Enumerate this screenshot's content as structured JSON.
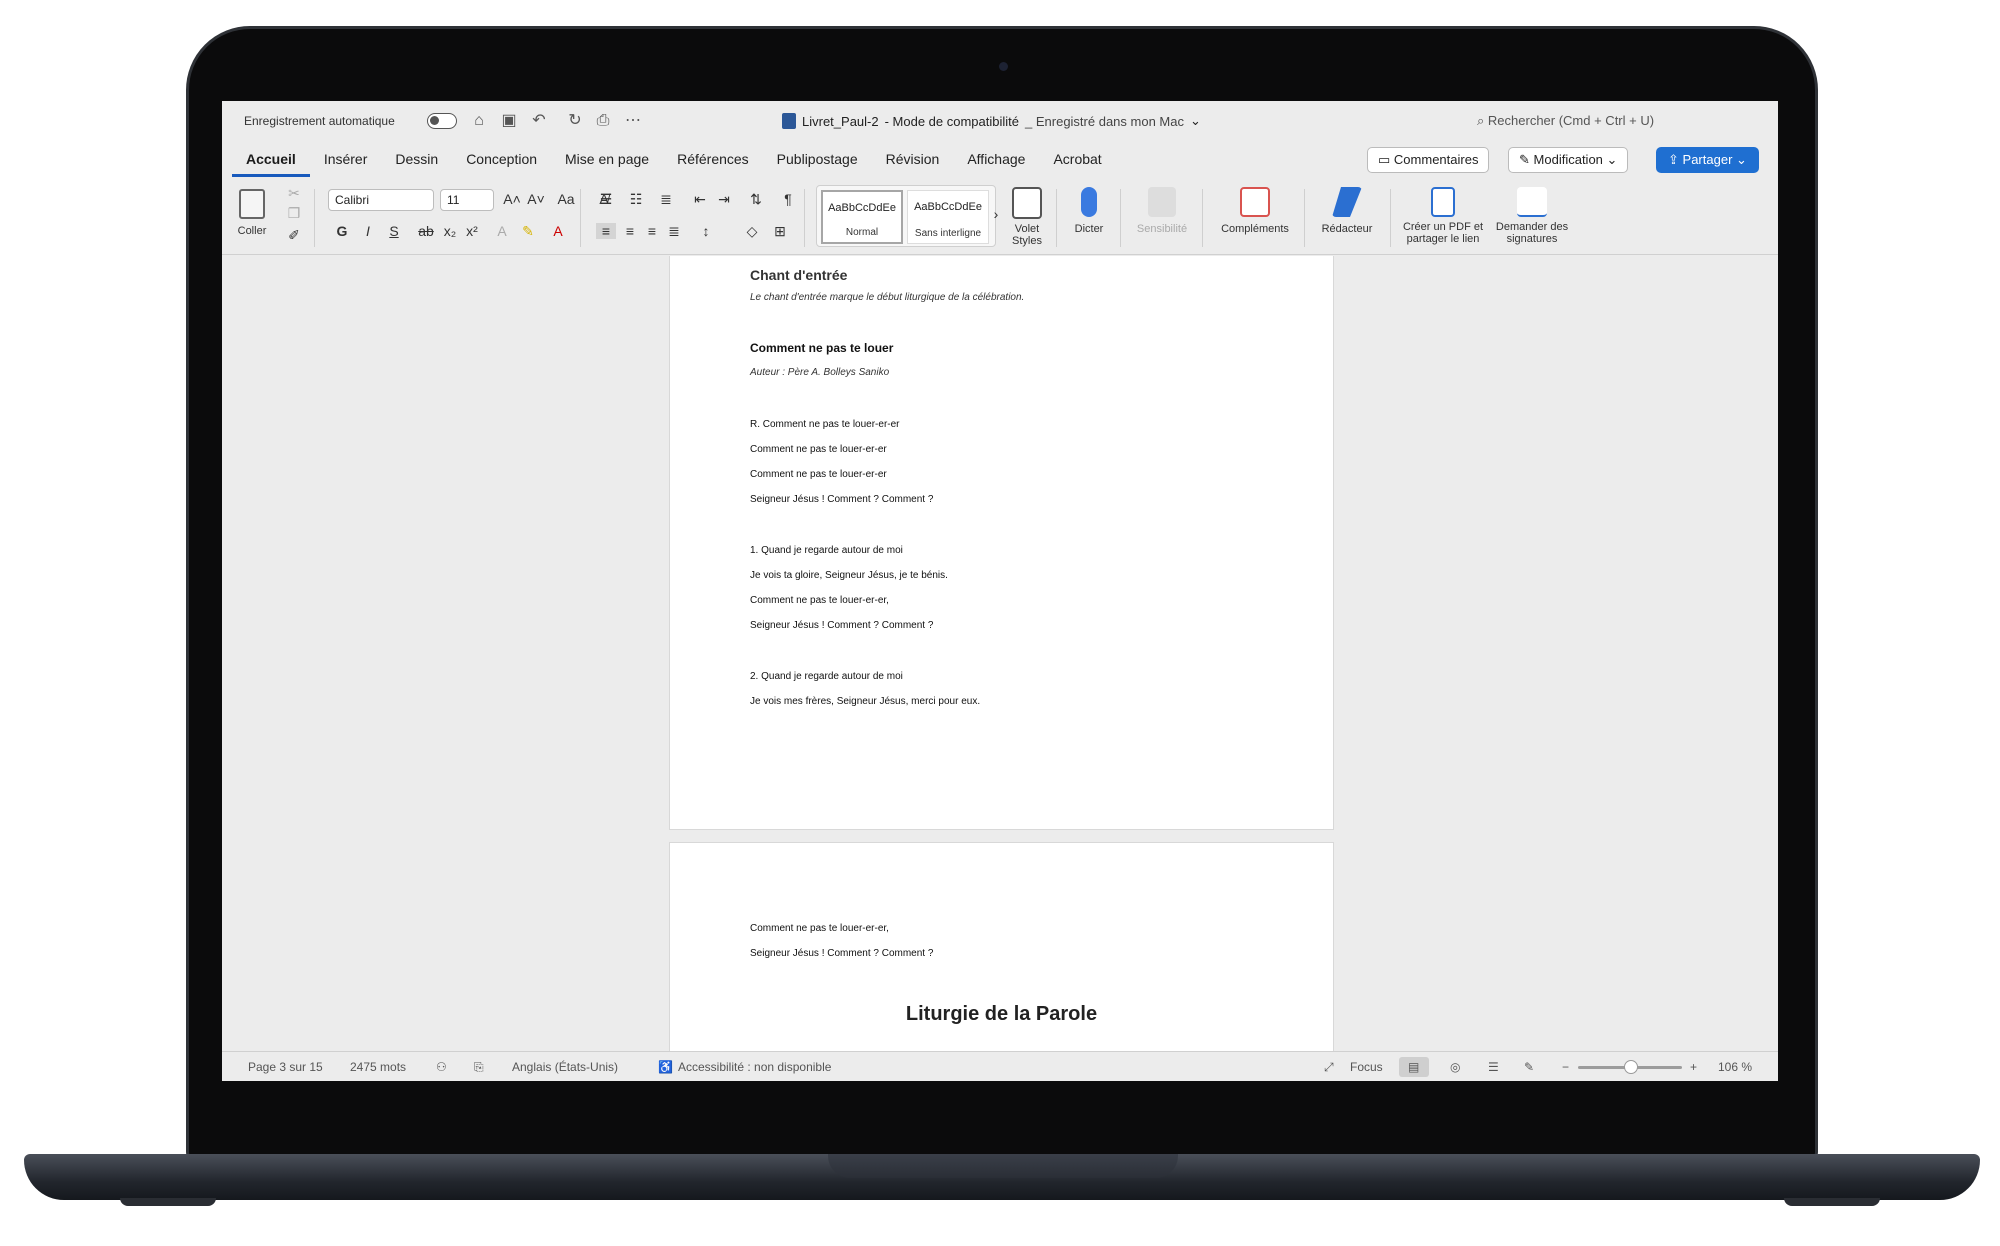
{
  "titlebar": {
    "autosave_label": "Enregistrement automatique",
    "doc_name": "Livret_Paul-2",
    "doc_mode": "-  Mode de compatibilité",
    "doc_saved": "_ Enregistré dans mon Mac",
    "search_placeholder": "Rechercher (Cmd + Ctrl + U)"
  },
  "tabs": [
    "Accueil",
    "Insérer",
    "Dessin",
    "Conception",
    "Mise en page",
    "Références",
    "Publipostage",
    "Révision",
    "Affichage",
    "Acrobat"
  ],
  "actions": {
    "comments": "Commentaires",
    "editing": "Modification",
    "share": "Partager"
  },
  "ribbon": {
    "paste": "Coller",
    "font_name": "Calibri",
    "font_size": "11",
    "bold": "G",
    "italic": "I",
    "underline": "S",
    "styles": [
      {
        "sample": "AaBbCcDdEe",
        "name": "Normal"
      },
      {
        "sample": "AaBbCcDdEe",
        "name": "Sans interligne"
      }
    ],
    "styles_pane": "Volet Styles",
    "dictate": "Dicter",
    "sensitivity": "Sensibilité",
    "addins": "Compléments",
    "editor": "Rédacteur",
    "create_pdf": "Créer un PDF et partager le lien",
    "request_signatures": "Demander des signatures"
  },
  "document": {
    "page1": {
      "heading": "Chant d'entrée",
      "intro": "Le chant d'entrée marque le début liturgique de la célébration.",
      "song_title": "Comment ne pas te louer",
      "author": "Auteur : Père A. Bolleys Saniko",
      "lines": [
        "R. Comment ne pas te louer-er-er",
        "Comment ne pas te louer-er-er",
        "Comment ne pas te louer-er-er",
        "Seigneur Jésus ! Comment ? Comment ?",
        "1. Quand je regarde autour de moi",
        "Je vois ta gloire, Seigneur Jésus, je te bénis.",
        "Comment ne pas te louer-er-er,",
        "Seigneur Jésus ! Comment ? Comment ?",
        "2. Quand je regarde autour de moi",
        "Je vois mes frères, Seigneur Jésus, merci pour eux."
      ]
    },
    "page2": {
      "lines": [
        "Comment ne pas te louer-er-er,",
        "Seigneur Jésus ! Comment ? Comment ?"
      ],
      "heading": "Liturgie de la Parole"
    }
  },
  "status": {
    "page": "Page 3 sur 15",
    "words": "2475 mots",
    "language": "Anglais (États-Unis)",
    "accessibility": "Accessibilité : non disponible",
    "focus": "Focus",
    "zoom": "106 %",
    "zoom_level": 1.06
  }
}
